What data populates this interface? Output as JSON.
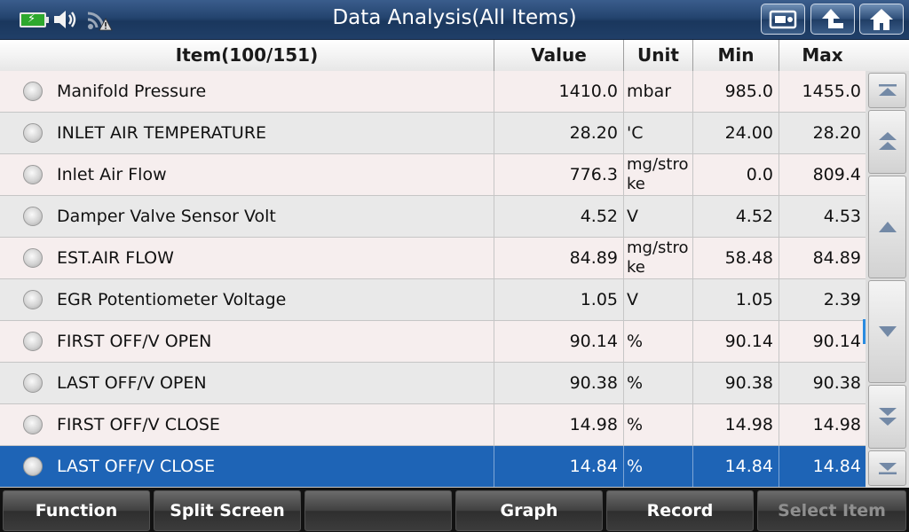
{
  "app": {
    "title": "Data Analysis(All Items)"
  },
  "status_icons": [
    "battery-charging-icon",
    "speaker-icon",
    "wifi-warning-icon"
  ],
  "top_buttons": [
    "screenshot-icon",
    "back-arrow-icon",
    "home-icon"
  ],
  "table": {
    "headers": {
      "item": "Item(100/151)",
      "value": "Value",
      "unit": "Unit",
      "min": "Min",
      "max": "Max"
    },
    "rows": [
      {
        "item": "Manifold Pressure",
        "value": "1410.0",
        "unit": "mbar",
        "min": "985.0",
        "max": "1455.0"
      },
      {
        "item": "INLET AIR TEMPERATURE",
        "value": "28.20",
        "unit": "'C",
        "min": "24.00",
        "max": "28.20"
      },
      {
        "item": "Inlet Air Flow",
        "value": "776.3",
        "unit": "mg/stro ke",
        "unit_line1": "mg/stro",
        "unit_line2": "ke",
        "min": "0.0",
        "max": "809.4"
      },
      {
        "item": "Damper Valve Sensor Volt",
        "value": "4.52",
        "unit": "V",
        "min": "4.52",
        "max": "4.53"
      },
      {
        "item": "EST.AIR FLOW",
        "value": "84.89",
        "unit": "mg/stro ke",
        "unit_line1": "mg/stro",
        "unit_line2": "ke",
        "min": "58.48",
        "max": "84.89"
      },
      {
        "item": "EGR Potentiometer Voltage",
        "value": "1.05",
        "unit": "V",
        "min": "1.05",
        "max": "2.39"
      },
      {
        "item": "FIRST OFF/V OPEN",
        "value": "90.14",
        "unit": "%",
        "min": "90.14",
        "max": "90.14"
      },
      {
        "item": "LAST OFF/V OPEN",
        "value": "90.38",
        "unit": "%",
        "min": "90.38",
        "max": "90.38"
      },
      {
        "item": "FIRST OFF/V CLOSE",
        "value": "14.98",
        "unit": "%",
        "min": "14.98",
        "max": "14.98"
      },
      {
        "item": "LAST OFF/V CLOSE",
        "value": "14.84",
        "unit": "%",
        "min": "14.84",
        "max": "14.84"
      }
    ],
    "selected_row_index": 9
  },
  "scroll_buttons": [
    "scroll-to-top-icon",
    "page-up-icon",
    "line-up-icon",
    "line-down-icon",
    "page-down-icon",
    "scroll-to-bottom-icon"
  ],
  "toolbar": {
    "function": "Function",
    "split_screen": "Split Screen",
    "blank": "",
    "graph": "Graph",
    "record": "Record",
    "select_item": "Select Item"
  },
  "colors": {
    "title_bar": "#24446f",
    "selected_row": "#1e64b6",
    "row_odd": "#f6eeee",
    "row_even": "#e9e9e9",
    "disabled_text": "#8f8f8f"
  }
}
